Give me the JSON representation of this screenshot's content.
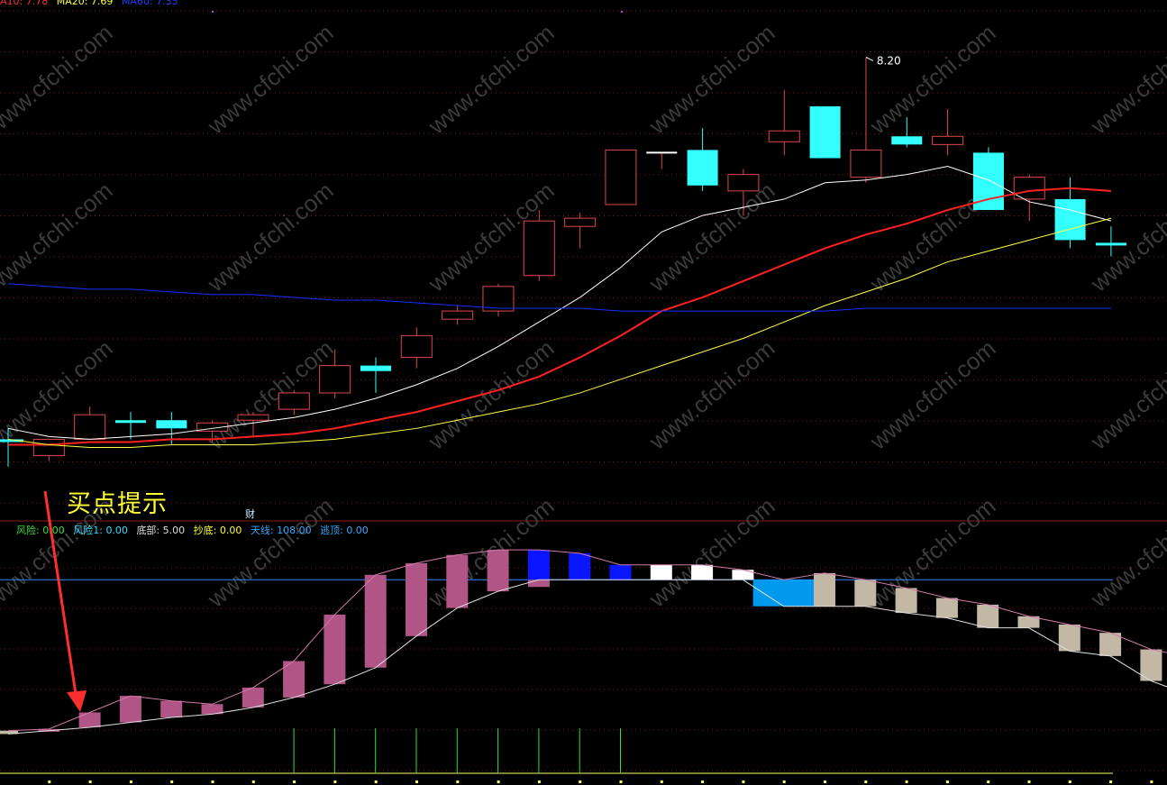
{
  "colors": {
    "up_candle": "#e0474c",
    "down_candle": "#33ffff",
    "ma10": "#ffffff",
    "ma20": "#ff2020",
    "ma30": "#ffff40",
    "ma60": "#1530ff",
    "osc_pink": "#b05585",
    "osc_blue": "#0a16ff",
    "osc_white": "#ffffff",
    "osc_cyan": "#0099ee",
    "osc_beige": "#c2b8a5",
    "annotation": "#ff2e2e",
    "label_yellow": "#ffff33"
  },
  "top_legend": [
    {
      "text": "A10: 7.78",
      "color": "#ff3030"
    },
    {
      "text": "MA20: 7.69",
      "color": "#ffff40"
    },
    {
      "text": "MA60: 7.35",
      "color": "#2040ff"
    }
  ],
  "annotation": {
    "buy_signal": "买点提示",
    "marker": "财"
  },
  "indicator_legend": [
    {
      "label": "风险:",
      "value": "0.00",
      "color": "#33dd33"
    },
    {
      "label": "风险1:",
      "value": "0.00",
      "color": "#33ddff"
    },
    {
      "label": "底部:",
      "value": "5.00",
      "color": "#dddddd"
    },
    {
      "label": "抄底:",
      "value": "0.00",
      "color": "#ffff33"
    },
    {
      "label": "天线:",
      "value": "108.00",
      "color": "#33aaff"
    },
    {
      "label": "逃顶:",
      "value": "0.00",
      "color": "#33aaff"
    }
  ],
  "watermark": "www.cfchi.com",
  "chart_data": [
    {
      "type": "candlestick",
      "title": "",
      "ylim": [
        6.6,
        8.35
      ],
      "max_label": "8.20",
      "candles": [
        {
          "o": 6.8,
          "h": 6.84,
          "l": 6.7,
          "c": 6.79
        },
        {
          "o": 6.74,
          "h": 6.8,
          "l": 6.72,
          "c": 6.8
        },
        {
          "o": 6.8,
          "h": 6.92,
          "l": 6.8,
          "c": 6.89
        },
        {
          "o": 6.87,
          "h": 6.9,
          "l": 6.8,
          "c": 6.86
        },
        {
          "o": 6.87,
          "h": 6.9,
          "l": 6.78,
          "c": 6.84
        },
        {
          "o": 6.83,
          "h": 6.87,
          "l": 6.79,
          "c": 6.86
        },
        {
          "o": 6.87,
          "h": 6.9,
          "l": 6.81,
          "c": 6.89
        },
        {
          "o": 6.91,
          "h": 6.98,
          "l": 6.89,
          "c": 6.97
        },
        {
          "o": 6.97,
          "h": 7.13,
          "l": 6.95,
          "c": 7.07
        },
        {
          "o": 7.07,
          "h": 7.1,
          "l": 6.97,
          "c": 7.05
        },
        {
          "o": 7.1,
          "h": 7.21,
          "l": 7.06,
          "c": 7.18
        },
        {
          "o": 7.24,
          "h": 7.29,
          "l": 7.22,
          "c": 7.27
        },
        {
          "o": 7.27,
          "h": 7.37,
          "l": 7.25,
          "c": 7.36
        },
        {
          "o": 7.4,
          "h": 7.64,
          "l": 7.38,
          "c": 7.6
        },
        {
          "o": 7.58,
          "h": 7.63,
          "l": 7.5,
          "c": 7.61
        },
        {
          "o": 7.66,
          "h": 7.86,
          "l": 7.66,
          "c": 7.86
        },
        {
          "o": 7.85,
          "h": 7.85,
          "l": 7.79,
          "c": 7.85
        },
        {
          "o": 7.86,
          "h": 7.94,
          "l": 7.71,
          "c": 7.73
        },
        {
          "o": 7.71,
          "h": 7.79,
          "l": 7.62,
          "c": 7.77
        },
        {
          "o": 7.89,
          "h": 8.08,
          "l": 7.84,
          "c": 7.93
        },
        {
          "o": 8.02,
          "h": 8.02,
          "l": 7.83,
          "c": 7.83
        },
        {
          "o": 7.76,
          "h": 8.2,
          "l": 7.74,
          "c": 7.86
        },
        {
          "o": 7.91,
          "h": 7.98,
          "l": 7.87,
          "c": 7.88
        },
        {
          "o": 7.88,
          "h": 8.01,
          "l": 7.84,
          "c": 7.91
        },
        {
          "o": 7.85,
          "h": 7.87,
          "l": 7.64,
          "c": 7.64
        },
        {
          "o": 7.68,
          "h": 7.77,
          "l": 7.6,
          "c": 7.76
        },
        {
          "o": 7.68,
          "h": 7.76,
          "l": 7.5,
          "c": 7.53
        },
        {
          "o": 7.52,
          "h": 7.58,
          "l": 7.47,
          "c": 7.51
        }
      ],
      "series": [
        {
          "name": "A10",
          "values": [
            6.84,
            6.81,
            6.8,
            6.81,
            6.82,
            6.84,
            6.86,
            6.88,
            6.91,
            6.95,
            7.0,
            7.06,
            7.14,
            7.23,
            7.32,
            7.43,
            7.56,
            7.62,
            7.65,
            7.68,
            7.74,
            7.75,
            7.77,
            7.8,
            7.75,
            7.67,
            7.64,
            7.6
          ]
        },
        {
          "name": "MA20",
          "values": [
            6.78,
            6.78,
            6.79,
            6.79,
            6.8,
            6.8,
            6.81,
            6.82,
            6.84,
            6.87,
            6.9,
            6.94,
            6.98,
            7.03,
            7.1,
            7.18,
            7.27,
            7.32,
            7.38,
            7.44,
            7.5,
            7.55,
            7.59,
            7.64,
            7.68,
            7.71,
            7.72,
            7.71
          ]
        },
        {
          "name": "MA30",
          "values": [
            6.8,
            6.78,
            6.77,
            6.77,
            6.78,
            6.78,
            6.78,
            6.79,
            6.8,
            6.82,
            6.84,
            6.87,
            6.9,
            6.93,
            6.97,
            7.02,
            7.07,
            7.12,
            7.17,
            7.23,
            7.29,
            7.34,
            7.39,
            7.45,
            7.49,
            7.53,
            7.57,
            7.61
          ]
        },
        {
          "name": "MA60",
          "values": [
            7.37,
            7.36,
            7.35,
            7.35,
            7.34,
            7.33,
            7.33,
            7.32,
            7.31,
            7.31,
            7.3,
            7.29,
            7.28,
            7.28,
            7.28,
            7.27,
            7.27,
            7.27,
            7.27,
            7.27,
            7.27,
            7.28,
            7.28,
            7.28,
            7.28,
            7.28,
            7.28,
            7.28
          ]
        }
      ]
    },
    {
      "type": "bar",
      "title": "",
      "ylim": [
        0,
        125
      ],
      "reference_line": 108,
      "bars": [
        {
          "a": 17,
          "b": 15,
          "k": "beige"
        },
        {
          "a": 18,
          "b": 17,
          "k": "pink"
        },
        {
          "a": 28,
          "b": 19,
          "k": "pink"
        },
        {
          "a": 38,
          "b": 22,
          "k": "pink"
        },
        {
          "a": 35,
          "b": 25,
          "k": "pink"
        },
        {
          "a": 33,
          "b": 27,
          "k": "pink"
        },
        {
          "a": 43,
          "b": 31,
          "k": "pink"
        },
        {
          "a": 59,
          "b": 37,
          "k": "pink"
        },
        {
          "a": 87,
          "b": 45,
          "k": "pink"
        },
        {
          "a": 111,
          "b": 55,
          "k": "pink"
        },
        {
          "a": 118,
          "b": 74,
          "k": "pink"
        },
        {
          "a": 123,
          "b": 91,
          "k": "pink"
        },
        {
          "a": 126,
          "b": 101,
          "k": "pink"
        },
        {
          "a": 126,
          "b": 108,
          "k": "blue"
        },
        {
          "a": 124,
          "b": 108,
          "k": "blue"
        },
        {
          "a": 117,
          "b": 108,
          "k": "blue"
        },
        {
          "a": 117,
          "b": 108,
          "k": "white"
        },
        {
          "a": 117,
          "b": 108,
          "k": "white"
        },
        {
          "a": 114,
          "b": 108,
          "k": "white"
        },
        {
          "a": 108,
          "b": 92,
          "k": "cyan"
        },
        {
          "a": 112,
          "b": 92,
          "k": "beige"
        },
        {
          "a": 108,
          "b": 92,
          "k": "beige"
        },
        {
          "a": 103,
          "b": 88,
          "k": "beige"
        },
        {
          "a": 97,
          "b": 85,
          "k": "beige"
        },
        {
          "a": 93,
          "b": 79,
          "k": "beige"
        },
        {
          "a": 86,
          "b": 79,
          "k": "beige"
        },
        {
          "a": 81,
          "b": 65,
          "k": "beige"
        },
        {
          "a": 76,
          "b": 62,
          "k": "beige"
        },
        {
          "a": 66,
          "b": 47,
          "k": "beige"
        },
        {
          "a": 61,
          "b": 38,
          "k": "beige"
        }
      ],
      "signal_bars": [
        7,
        8,
        9,
        10,
        11,
        12,
        13,
        14,
        15
      ]
    }
  ]
}
